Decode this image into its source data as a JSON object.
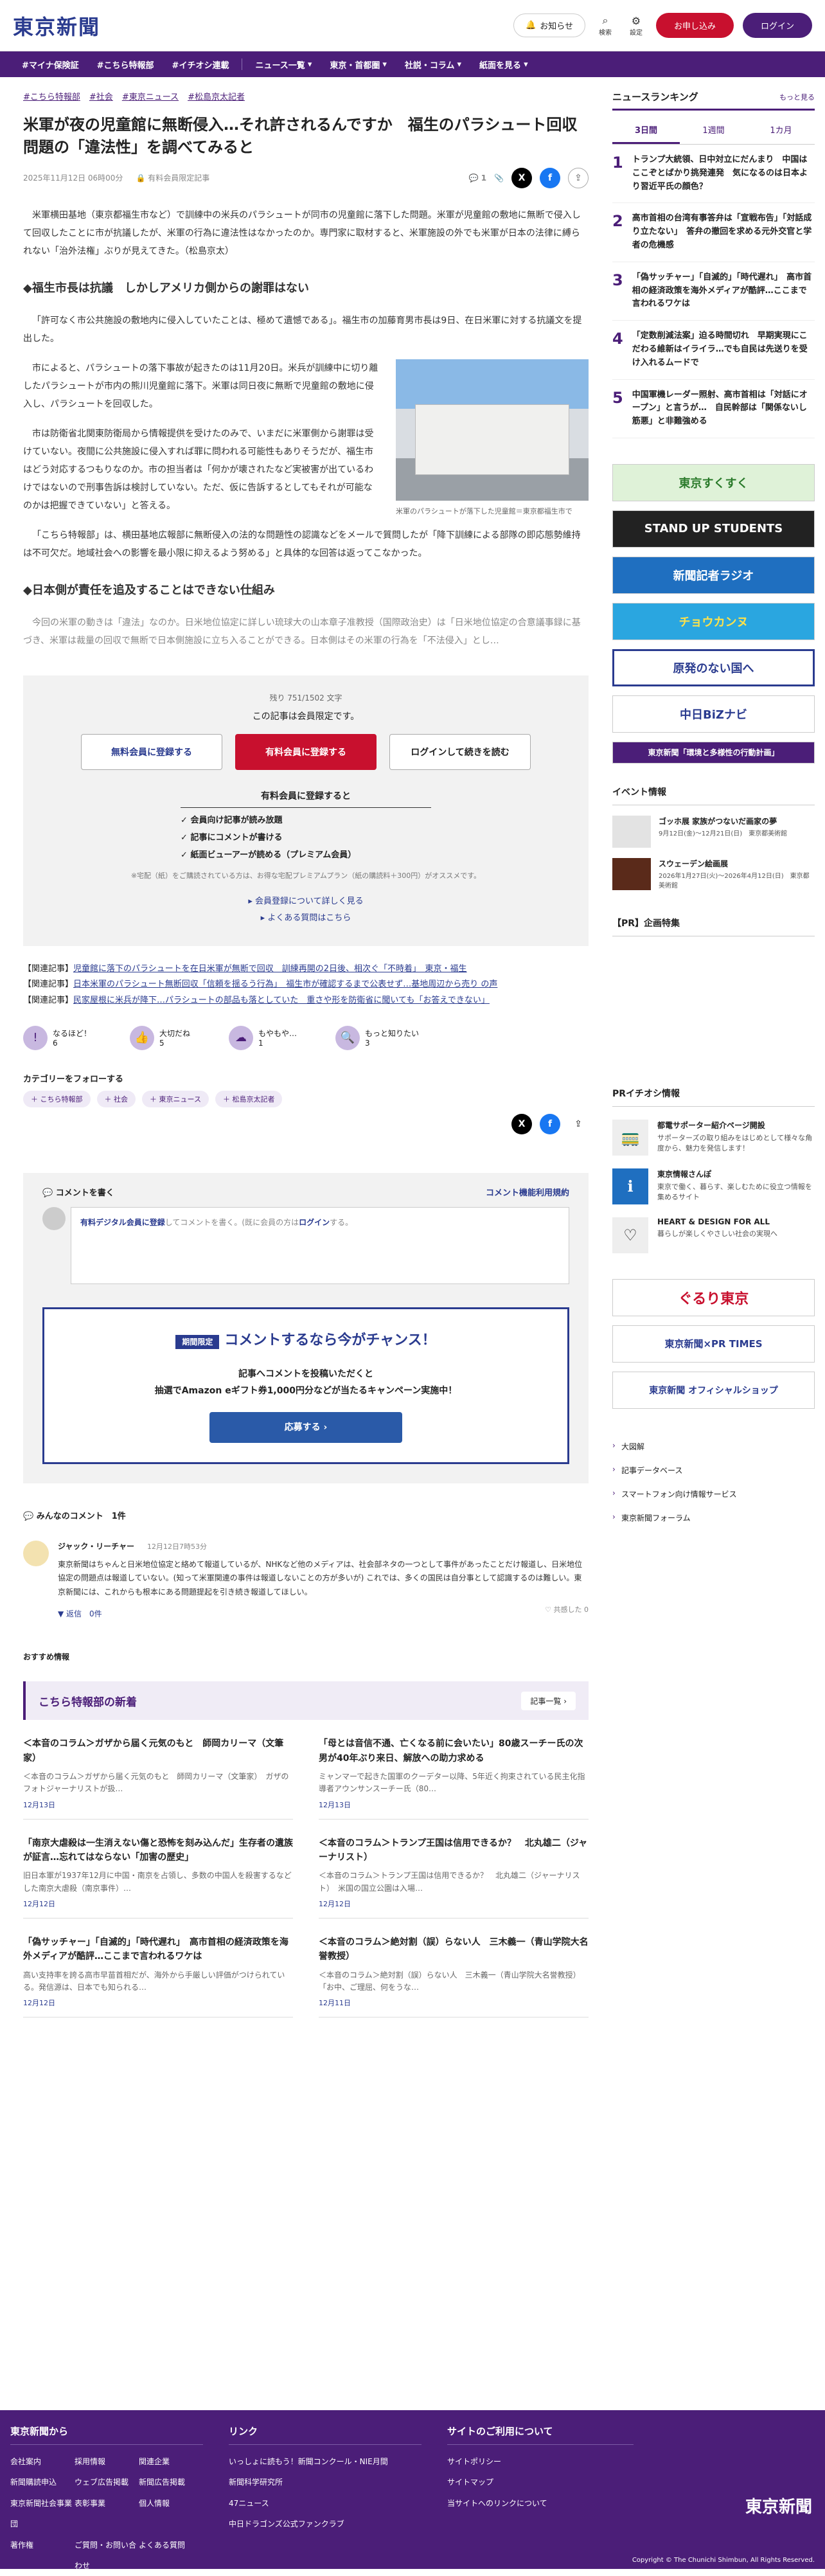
{
  "header": {
    "logo": "東京新聞",
    "notify": "お知らせ",
    "search": "検索",
    "settings": "設定",
    "apply": "お申し込み",
    "login": "ログイン"
  },
  "nav": {
    "items": [
      "#マイナ保険証",
      "#こちら特報部",
      "#イチオシ連載",
      "ニュース一覧",
      "東京・首都圏",
      "社説・コラム",
      "紙面を見る"
    ]
  },
  "article": {
    "tags": [
      "#こちら特報部",
      "#社会",
      "#東京ニュース",
      "#松島京太記者"
    ],
    "title": "米軍が夜の児童館に無断侵入…それ許されるんですか　福生のパラシュート回収問題の「違法性」を調べてみると",
    "date": "2025年11月12日 06時00分",
    "paid": "有料会員限定記事",
    "comment_count": "1",
    "lead": "米軍横田基地（東京都福生市など）で訓練中の米兵のパラシュートが同市の児童館に落下した問題。米軍が児童館の敷地に無断で侵入して回収したことに市が抗議したが、米軍の行為に違法性はなかったのか。専門家に取材すると、米軍施設の外でも米軍が日本の法律に縛られない「治外法権」ぶりが見えてきた。（松島京太）",
    "h1": "◆福生市長は抗議　しかしアメリカ側からの謝罪はない",
    "p1": "「許可なく市公共施設の敷地内に侵入していたことは、極めて遺憾である」。福生市の加藤育男市長は9日、在日米軍に対する抗議文を提出した。",
    "p2": "市によると、パラシュートの落下事故が起きたのは11月20日。米兵が訓練中に切り離したパラシュートが市内の熊川児童館に落下。米軍は同日夜に無断で児童館の敷地に侵入し、パラシュートを回収した。",
    "p3": "市は防衛省北関東防衛局から情報提供を受けたのみで、いまだに米軍側から謝罪は受けていない。夜間に公共施設に侵入すれば罪に問われる可能性もありそうだが、福生市はどう対応するつもりなのか。市の担当者は「何かが壊されたなど実被害が出ているわけではないので刑事告訴は検討していない。ただ、仮に告訴するとしてもそれが可能なのかは把握できていない」と答える。",
    "p4": "「こちら特報部」は、横田基地広報部に無断侵入の法的な問題性の認識などをメールで質問したが「降下訓練による部隊の即応態勢維持は不可欠だ。地域社会への影響を最小限に抑えるよう努める」と具体的な回答は返ってこなかった。",
    "h2": "◆日本側が責任を追及することはできない仕組み",
    "p5": "今回の米軍の動きは「違法」なのか。日米地位協定に詳しい琉球大の山本章子准教授（国際政治史）は「日米地位協定の合意議事録に基づき、米軍は裁量の回収で無断で日本側施設に立ち入ることができる。日本側はその米軍の行為を「不法侵入」とし…",
    "figure_caption": "米軍のパラシュートが落下した児童館＝東京都福生市で"
  },
  "paywall": {
    "rest": "残り 751/1502 文字",
    "lead": "この記事は会員限定です。",
    "btn_free": "無料会員に登録する",
    "btn_paid": "有料会員に登録する",
    "btn_login": "ログインして続きを読む",
    "benefit_title": "有料会員に登録すると",
    "benefits": [
      "会員向け記事が読み放題",
      "記事にコメントが書ける",
      "紙面ビューアーが読める（プレミアム会員）"
    ],
    "note": "※宅配（紙）をご購読されている方は、お得な宅配プレミアムプラン（紙の購読料＋300円）がオススメです。",
    "link1": "会員登録について詳しく見る",
    "link2": "よくある質問はこちら"
  },
  "related": [
    {
      "label": "【関連記事】",
      "text": "児童館に落下のパラシュートを在日米軍が無断で回収　訓練再開の2日後、相次ぐ「不時着」　東京・福生"
    },
    {
      "label": "【関連記事】",
      "text": "日本米軍のパラシュート無断回収「信頼を揺るう行為」　福生市が確認するまで公表せず…基地周辺から売り の声"
    },
    {
      "label": "【関連記事】",
      "text": "民家屋根に米兵が降下…パラシュートの部品も落としていた　重さや形を防衛省に聞いても「お答えできない」"
    }
  ],
  "reactions": [
    {
      "label": "なるほど！",
      "count": "6"
    },
    {
      "label": "大切だね",
      "count": "5"
    },
    {
      "label": "もやもや…",
      "count": "1"
    },
    {
      "label": "もっと知りたい",
      "count": "3"
    }
  ],
  "follow": {
    "title": "カテゴリーをフォローする",
    "tags": [
      "＋ こちら特報部",
      "＋ 社会",
      "＋ 東京ニュース",
      "＋ 松島京太記者"
    ]
  },
  "comments": {
    "title": "コメントを書く",
    "rules": "コメント機能利用規約",
    "placeholder_pre": "有料デジタル会員に登録",
    "placeholder_mid": "してコメントを書く。(既に会員の方は",
    "placeholder_login": "ログイン",
    "placeholder_end": "する。",
    "campaign_badge": "期間限定",
    "campaign_title": "コメントするなら今がチャンス！",
    "campaign_t1": "記事へコメントを投稿いただくと",
    "campaign_t2": "抽選でAmazon eギフト券1,000円分などが当たるキャンペーン実施中！",
    "campaign_btn": "応募する",
    "all_title": "みんなのコメント　1件",
    "user": "ジャック・リーチャー",
    "user_date": "12月12日7時53分",
    "text": "東京新聞はちゃんと日米地位協定と絡めて報道しているが、NHKなど他のメディアは、社会部ネタの一つとして事件があったことだけ報道し、日米地位協定の問題点は報道していない。(知って米軍関連の事件は報道しないことの方が多いが) これでは、多くの国民は自分事として認識するのは難しい。東京新聞には、これからも根本にある問題提起を引き続き報道してほしい。",
    "reply": "返信　0件",
    "helpful": "共感した 0"
  },
  "recommend": {
    "head": "おすすめ情報",
    "newest": "こちら特報部の新着",
    "more": "記事一覧",
    "cards": [
      {
        "t": "＜本音のコラム＞ガザから届く元気のもと　師岡カリーマ（文筆家）",
        "s": "＜本音のコラム＞ガザから届く元気のもと　師岡カリーマ（文筆家）　ガザのフォトジャーナリストが扱…",
        "d": "12月13日"
      },
      {
        "t": "「母とは音信不通、亡くなる前に会いたい」80歳スーチー氏の次男が40年ぶり来日、解放への助力求める",
        "s": "ミャンマーで起きた国軍のクーデター以降、5年近く拘束されている民主化指導者アウンサンスーチー氏（80…",
        "d": "12月13日"
      },
      {
        "t": "「南京大虐殺は一生消えない傷と恐怖を刻み込んだ」生存者の遺族が証言…忘れてはならない「加害の歴史」",
        "s": "旧日本軍が1937年12月に中国・南京を占領し、多数の中国人を殺害するなどした南京大虐殺（南京事件）…",
        "d": "12月12日"
      },
      {
        "t": "＜本音のコラム＞トランプ王国は信用できるか？　北丸雄二（ジャーナリスト）",
        "s": "＜本音のコラム＞トランプ王国は信用できるか？　北丸雄二（ジャーナリスト）　米国の国立公園は入場…",
        "d": "12月12日"
      },
      {
        "t": "「偽サッチャー」「自滅的」「時代遅れ」　高市首相の経済政策を海外メディアが酷評…ここまで言われるワケは",
        "s": "高い支持率を誇る高市早苗首相だが、海外から手厳しい評価がつけられている。発信源は、日本でも知られる…",
        "d": "12月12日"
      },
      {
        "t": "＜本音のコラム＞絶対割（誤）らない人　三木義一（青山学院大名誉教授）",
        "s": "＜本音のコラム＞絶対割（誤）らない人　三木義一（青山学院大名誉教授）　「お中、ご理屈、何をうな…",
        "d": "12月11日"
      }
    ]
  },
  "sidebar": {
    "ranking_title": "ニュースランキング",
    "ranking_more": "もっと見る",
    "tabs": [
      "3日間",
      "1週間",
      "1カ月"
    ],
    "ranking": [
      {
        "n": "1",
        "t": "トランプ大統領、日中対立にだんまり　中国はここぞとばかり挑発連発　気になるのは日本より習近平氏の顔色？"
      },
      {
        "n": "2",
        "t": "高市首相の台湾有事答弁は「宣戦布告」「対話成り立たない」　答弁の撤回を求める元外交官と学者の危機感"
      },
      {
        "n": "3",
        "t": "「偽サッチャー」「自滅的」「時代遅れ」　高市首相の経済政策を海外メディアが酷評…ここまで言われるワケは"
      },
      {
        "n": "4",
        "t": "「定数削減法案」迫る時間切れ　早期実現にこだわる維新はイライラ…でも自民は先送りを受け入れるムードで"
      },
      {
        "n": "5",
        "t": "中国軍機レーダー照射、高市首相は「対話にオープン」と言うが…　自民幹部は「関係ないし筋悪」と非難強める"
      }
    ],
    "banners": [
      "東京すくすく",
      "STAND UP STUDENTS",
      "新聞記者ラジオ",
      "チョウカンヌ",
      "原発のない国へ",
      "中日BiZナビ",
      "東京新聞「環境と多様性の行動計画」"
    ],
    "events_title": "イベント情報",
    "events": [
      {
        "t": "ゴッホ展 家族がつないだ画家の夢",
        "d": "9月12日(金)～12月21日(日)　東京都美術館"
      },
      {
        "t": "スウェーデン絵画展",
        "d": "2026年1月27日(火)～2026年4月12日(日)　東京都美術館"
      }
    ],
    "pr_title": "【PR】企画特集",
    "pri_title": "PRイチオシ情報",
    "pri": [
      {
        "t": "都電サポーター紹介ページ開設",
        "d": "サポーターズの取り組みをはじめとして様々な角度から、魅力を発信します！",
        "icon": "train-icon",
        "g": "🚃"
      },
      {
        "t": "東京情報さんぽ",
        "d": "東京で働く、暮らす、楽しむために役立つ情報を集めるサイト",
        "icon": "info-icon",
        "g": "ℹ"
      },
      {
        "t": "HEART & DESIGN FOR ALL",
        "d": "暮らしが楽しくやさしい社会の実現へ",
        "icon": "heart-icon",
        "g": "♡"
      }
    ],
    "banners2": [
      "ぐるり東京",
      "東京新聞×PR TIMES",
      "東京新聞 オフィシャルショップ"
    ],
    "links": [
      "大図解",
      "記事データベース",
      "スマートフォン向け情報サービス",
      "東京新聞フォーラム"
    ]
  },
  "footer": {
    "col1": "東京新聞から",
    "col1_items": [
      "会社案内",
      "採用情報",
      "関連企業",
      "新聞購読申込",
      "ウェブ広告掲載",
      "新聞広告掲載",
      "東京新聞社会事業団",
      "表彰事業",
      "個人情報",
      "著作権",
      "ご質問・お問い合わせ",
      "よくある質問"
    ],
    "col2": "リンク",
    "col2_items": [
      "いっしょに読もう！新聞コンクール・NIE月間",
      "新聞科学研究所",
      "47ニュース",
      "中日ドラゴンズ公式ファンクラブ"
    ],
    "col3": "サイトのご利用について",
    "col3_items": [
      "サイトポリシー",
      "サイトマップ",
      "当サイトへのリンクについて"
    ],
    "logo": "東京新聞",
    "copy": "Copyright © The Chunichi Shimbun, All Rights Reserved."
  },
  "colors": {
    "brand": "#4b1e78",
    "accent": "#c8102e",
    "link": "#2a3b8f"
  }
}
